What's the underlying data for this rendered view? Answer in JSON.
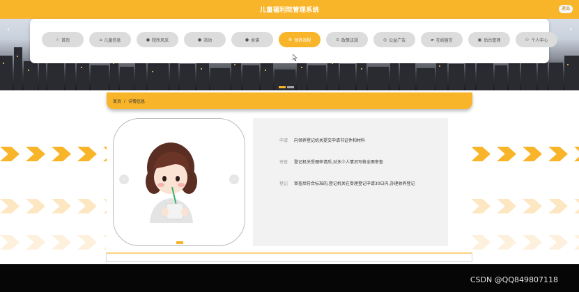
{
  "header": {
    "title": "儿童福利院管理系统",
    "logout_label": "退出"
  },
  "nav": {
    "items": [
      {
        "icon": "☆",
        "label": "首页",
        "active": false
      },
      {
        "icon": "⌂",
        "label": "儿童信息",
        "active": false
      },
      {
        "icon": "●",
        "label": "院所风采",
        "active": false
      },
      {
        "icon": "●",
        "label": "活动",
        "active": false
      },
      {
        "icon": "●",
        "label": "食谱",
        "active": false
      },
      {
        "icon": "⚙",
        "label": "领养流程",
        "active": true
      },
      {
        "icon": "⊙",
        "label": "政策法规",
        "active": false
      },
      {
        "icon": "◎",
        "label": "公益广告",
        "active": false
      },
      {
        "icon": "▰",
        "label": "在线留言",
        "active": false
      },
      {
        "icon": "▣",
        "label": "后台管理",
        "active": false
      },
      {
        "icon": "⚇",
        "label": "个人中心",
        "active": false
      }
    ]
  },
  "breadcrumb": {
    "home": "首页",
    "separator": "/",
    "current": "详情信息"
  },
  "detail": {
    "rows": [
      {
        "label": "申请",
        "value": "向领养登记机关提交申请书证件和材料"
      },
      {
        "label": "审查",
        "value": "登记机关受理申请后,对多少人情况写核全面审查"
      },
      {
        "label": "登记",
        "value": "审查后符合标准的,登记机关在受理登记申请30日内,办理收养登记"
      }
    ]
  },
  "watermark": "CSDN @QQ849807118",
  "colors": {
    "accent": "#f9b52a",
    "panel": "#f2f2f2"
  }
}
